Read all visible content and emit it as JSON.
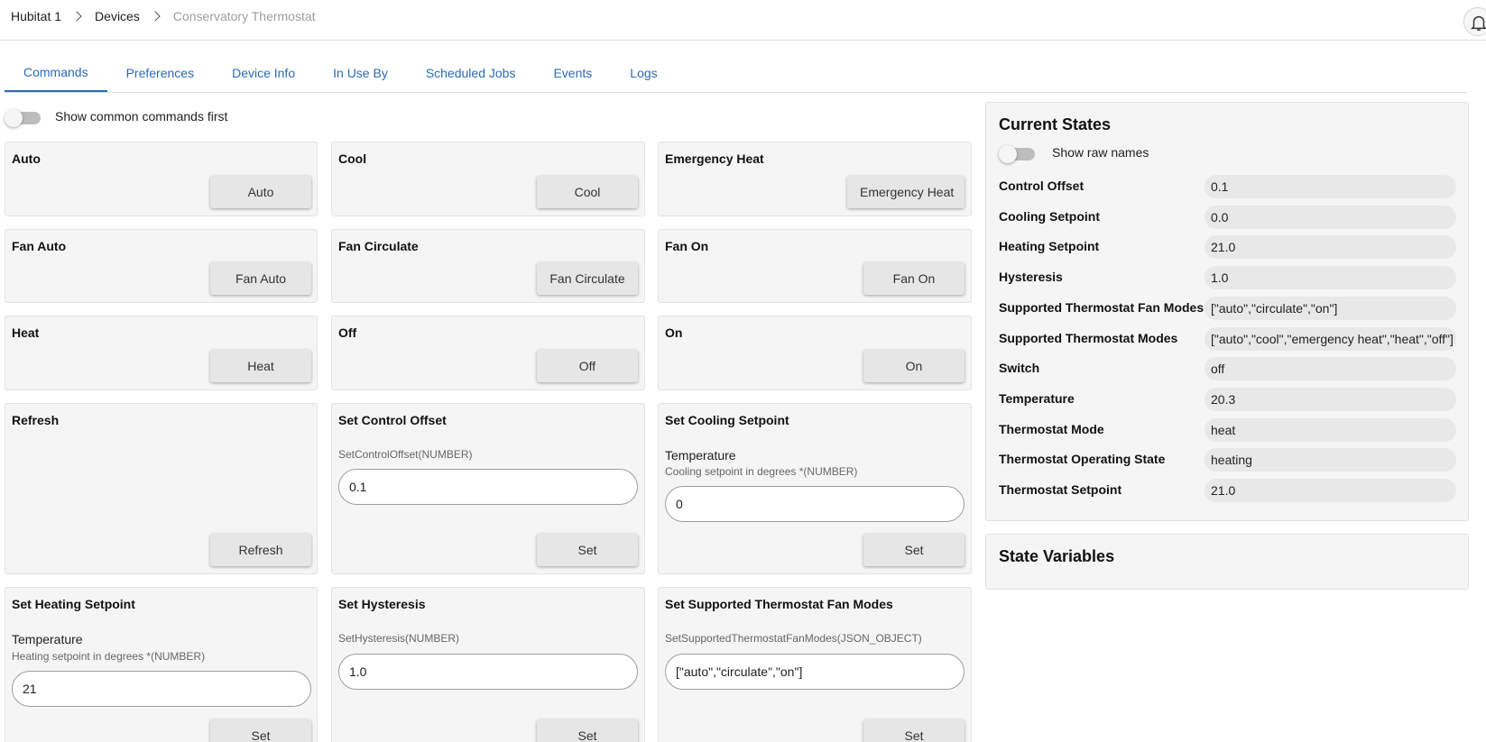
{
  "breadcrumb": [
    "Hubitat 1",
    "Devices",
    "Conservatory Thermostat"
  ],
  "tabs": [
    "Commands",
    "Preferences",
    "Device Info",
    "In Use By",
    "Scheduled Jobs",
    "Events",
    "Logs"
  ],
  "commands_toggle_label": "Show common commands first",
  "commands": {
    "auto": {
      "title": "Auto",
      "button": "Auto"
    },
    "cool": {
      "title": "Cool",
      "button": "Cool"
    },
    "emergency_heat": {
      "title": "Emergency Heat",
      "button": "Emergency Heat"
    },
    "fan_auto": {
      "title": "Fan Auto",
      "button": "Fan Auto"
    },
    "fan_circulate": {
      "title": "Fan Circulate",
      "button": "Fan Circulate"
    },
    "fan_on": {
      "title": "Fan On",
      "button": "Fan On"
    },
    "heat": {
      "title": "Heat",
      "button": "Heat"
    },
    "off": {
      "title": "Off",
      "button": "Off"
    },
    "on": {
      "title": "On",
      "button": "On"
    },
    "refresh": {
      "title": "Refresh",
      "button": "Refresh"
    },
    "set_control_offset": {
      "title": "Set Control Offset",
      "hint": "SetControlOffset(NUMBER)",
      "value": "0.1",
      "button": "Set"
    },
    "set_cooling_setpoint": {
      "title": "Set Cooling Setpoint",
      "label": "Temperature",
      "hint": "Cooling setpoint in degrees *(NUMBER)",
      "value": "0",
      "button": "Set"
    },
    "set_heating_setpoint": {
      "title": "Set Heating Setpoint",
      "label": "Temperature",
      "hint": "Heating setpoint in degrees *(NUMBER)",
      "value": "21",
      "button": "Set"
    },
    "set_hysteresis": {
      "title": "Set Hysteresis",
      "hint": "SetHysteresis(NUMBER)",
      "value": "1.0",
      "button": "Set"
    },
    "set_fan_modes": {
      "title": "Set Supported Thermostat Fan Modes",
      "hint": "SetSupportedThermostatFanModes(JSON_OBJECT)",
      "value": "[\"auto\",\"circulate\",\"on\"]",
      "button": "Set"
    }
  },
  "current_states": {
    "title": "Current States",
    "toggle_label": "Show raw names",
    "rows": [
      {
        "name": "Control Offset",
        "value": "0.1"
      },
      {
        "name": "Cooling Setpoint",
        "value": "0.0"
      },
      {
        "name": "Heating Setpoint",
        "value": "21.0"
      },
      {
        "name": "Hysteresis",
        "value": "1.0"
      },
      {
        "name": "Supported Thermostat Fan Modes",
        "value": "[\"auto\",\"circulate\",\"on\"]"
      },
      {
        "name": "Supported Thermostat Modes",
        "value": "[\"auto\",\"cool\",\"emergency heat\",\"heat\",\"off\"]"
      },
      {
        "name": "Switch",
        "value": "off"
      },
      {
        "name": "Temperature",
        "value": "20.3"
      },
      {
        "name": "Thermostat Mode",
        "value": "heat"
      },
      {
        "name": "Thermostat Operating State",
        "value": "heating"
      },
      {
        "name": "Thermostat Setpoint",
        "value": "21.0"
      }
    ]
  },
  "state_variables": {
    "title": "State Variables"
  },
  "colors": {
    "accent": "#2a6bb5",
    "card_bg": "#f5f5f5",
    "button_bg": "#e6e6e6"
  }
}
